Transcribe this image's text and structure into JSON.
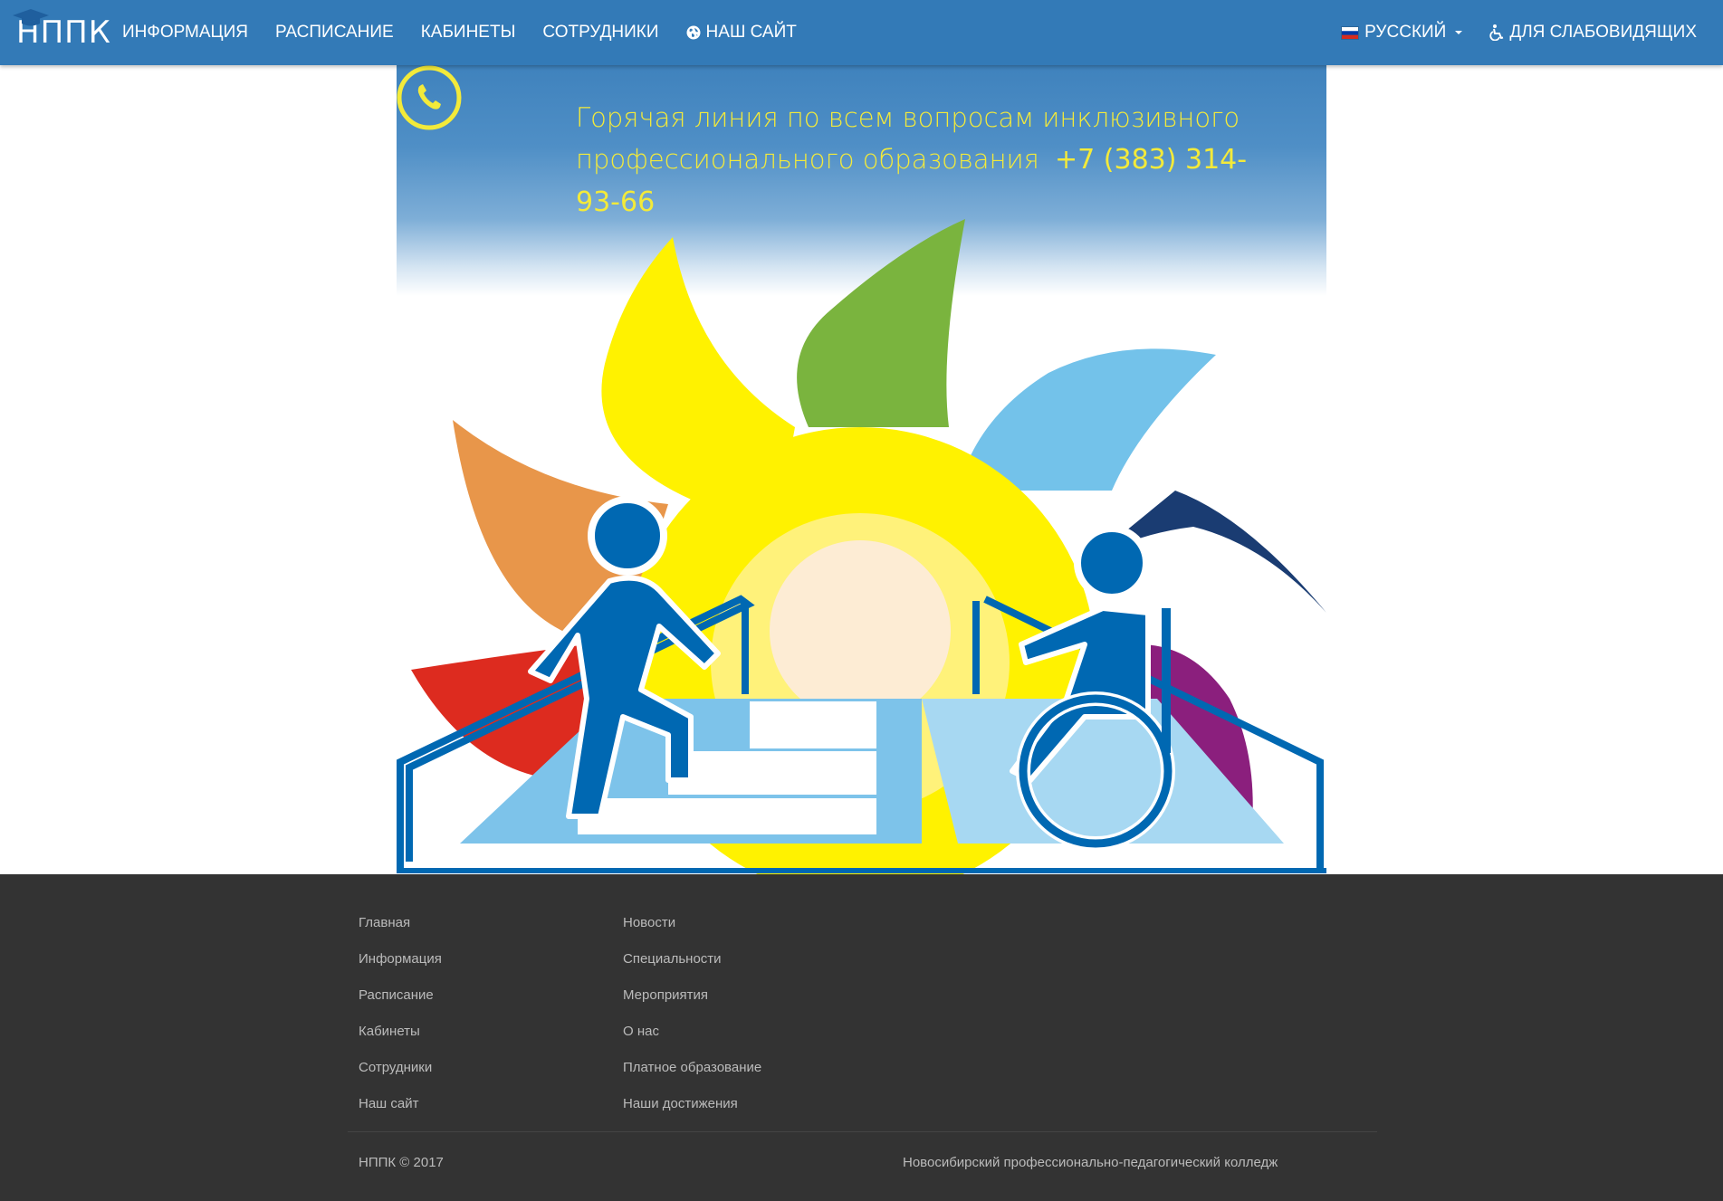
{
  "navbar": {
    "brand": "НППК",
    "links": [
      {
        "label": "Информация"
      },
      {
        "label": "Расписание"
      },
      {
        "label": "Кабинеты"
      },
      {
        "label": "Сотрудники"
      },
      {
        "label": "Наш сайт",
        "icon": "globe-icon"
      }
    ],
    "language": {
      "label": "Русский",
      "icon": "russian-flag-icon"
    },
    "accessibility": {
      "label": "Для слабовидящих",
      "icon": "wheelchair-icon"
    }
  },
  "banner": {
    "hotline_text_line1": "Горячая линия по всем вопросам инклюзивного",
    "hotline_text_line2": "профессионального образования",
    "hotline_phone": "+7 (383) 314-93-66",
    "text_color": "#f3ea3a"
  },
  "footer": {
    "col1": [
      "Главная",
      "Информация",
      "Расписание",
      "Кабинеты",
      "Сотрудники",
      "Наш сайт"
    ],
    "col2": [
      "Новости",
      "Специальности",
      "Мероприятия",
      "О нас",
      "Платное образование",
      "Наши достижения"
    ],
    "copyright": "НППК © 2017",
    "college_name": "Новосибирский профессионально-педагогический колледж"
  },
  "colors": {
    "navbar_bg": "#337ab7",
    "footer_bg": "#333333",
    "footer_text": "#bbbbbb"
  }
}
